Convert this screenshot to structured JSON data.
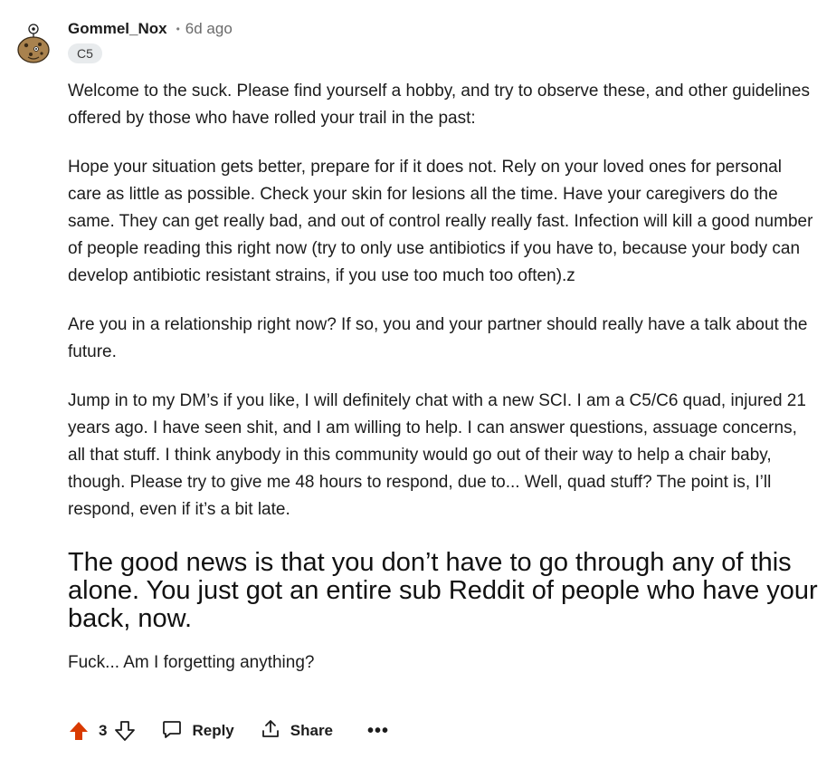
{
  "comment": {
    "author": "Gommel_Nox",
    "separator": "•",
    "timestamp": "6d ago",
    "flair": "C5",
    "paragraphs": [
      "Welcome to the suck. Please find yourself a hobby, and try to observe these, and other guidelines offered by those who have rolled your trail in the past:",
      "Hope your situation gets better, prepare for if it does not. Rely on your loved ones for personal care as little as possible. Check your skin for lesions all the time. Have your caregivers do the same. They can get really bad, and out of control really really fast. Infection will kill a good number of people reading this right now (try to only use antibiotics if you have to, because your body can develop antibiotic resistant strains, if you use too much too often).z",
      "Are you in a relationship right now? If so, you and your partner should really have a talk about the future.",
      "Jump in to my DM’s if you like, I will definitely chat with a new SCI. I am a C5/C6 quad, injured 21 years ago. I have seen shit, and I am willing to help. I can answer questions, assuage concerns, all that stuff. I think anybody in this community would go out of their way to help a chair baby, though. Please try to give me 48 hours to respond, due to... Well, quad stuff? The point is, I’ll respond, even if it’s a bit late."
    ],
    "heading": "The good news is that you don’t have to go through any of this alone. You just got an entire sub Reddit of people who have your back, now.",
    "closing": "Fuck... Am I forgetting anything?"
  },
  "actions": {
    "score": "3",
    "reply_label": "Reply",
    "share_label": "Share",
    "more_label": "•••"
  },
  "icons": {
    "upvote": "upvote-icon",
    "downvote": "downvote-icon",
    "reply": "reply-icon",
    "share": "share-icon",
    "more": "more-icon",
    "avatar": "avatar"
  },
  "colors": {
    "upvote_active": "#d93a00",
    "flair_bg": "#e8ebed",
    "text": "#1c1c1c",
    "meta": "#6b6b6b"
  }
}
